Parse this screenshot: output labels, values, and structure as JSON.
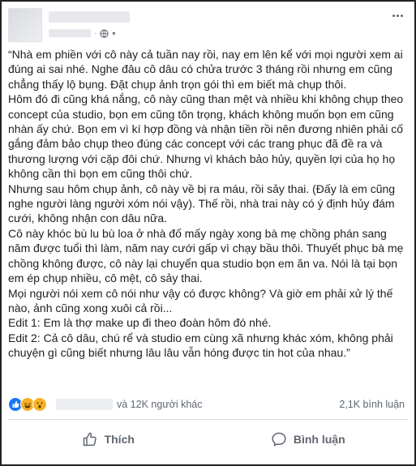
{
  "post": {
    "body": "“Nhà em phiền với cô này cả tuần nay rồi, nay em lên kể với mọi người xem ai đúng ai sai nhé. Nghe đâu cô dâu có chửa trước 3 tháng rồi nhưng em cũng chẳng thấy lộ bụng. Đặt chụp ảnh trọn gói thì em biết mà chụp thôi.\nHôm đó đi cũng khá nắng, cô này cũng than mệt và nhiều khi không chụp theo concept của studio, bọn em cũng tôn trọng, khách không muốn bọn em cũng nhàn ấy chứ. Bọn em vì kí hợp đồng và nhận tiền rồi nên đương nhiên phải cố gắng đảm bảo chụp theo đúng các concept với các trang phục đã đề ra và thương lượng với cặp đôi chứ. Nhưng vì khách bảo hủy, quyền lợi của họ họ không cần thì bọn em cũng thôi chứ.\nNhưng sau hôm chụp ảnh, cô này về bị ra máu, rồi sảy thai. (Đấy là em cũng nghe người làng người xóm nói vậy). Thế rồi, nhà trai này có ý định hủy đám cưới, không nhận con dâu nữa.\nCô này khóc bù lu bù loa ở nhà đố mấy ngày xong bà mẹ chồng phán sang năm được tuổi thì làm, năm nay cưới gấp vì chạy bầu thôi. Thuyết phục bà mẹ chồng không được, cô này lại chuyển qua studio bọn em ăn va. Nói là tại bọn em ép chụp nhiều, cô mệt, cô sảy thai.\nMọi người nói xem cô nói như vậy có được không? Và giờ em phải xử lý thế nào, ảnh cũng xong xuôi cả rồi...\nEdit 1: Em là thợ make up đi theo đoàn hôm đó nhé.\nEdit 2: Cả cô dâu, chú rể và studio em cùng xã nhưng khác xóm, không phải chuyện gì cũng biết nhưng lâu lâu vẫn hóng được tin hot của nhau.”"
  },
  "stats": {
    "others": "và 12K người khác",
    "comments": "2,1K bình luận"
  },
  "actions": {
    "like_label": "Thích",
    "comment_label": "Bình luận"
  },
  "icons": {
    "privacy": "globe-icon",
    "privacy_menu": "caret-down-icon",
    "more": "more-options-icon",
    "like": "thumbs-up-icon",
    "comment": "speech-bubble-icon",
    "reactions": [
      "like-reaction-icon",
      "haha-reaction-icon",
      "wow-reaction-icon"
    ]
  },
  "colors": {
    "text": "#1c1e21",
    "secondary": "#606770",
    "like_blue": "#1877f2",
    "reaction_yellow": "#f7b125"
  }
}
